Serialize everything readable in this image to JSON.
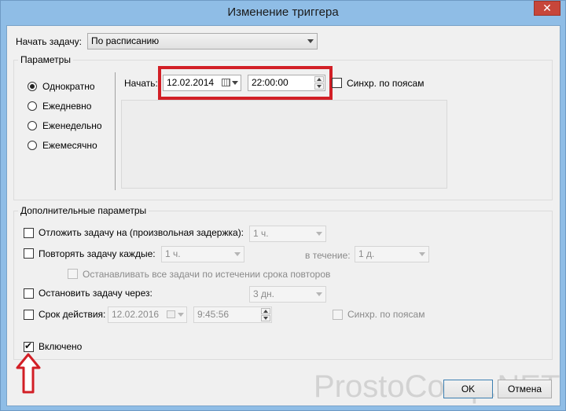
{
  "window": {
    "title": "Изменение триггера",
    "close_glyph": "✕"
  },
  "begin_task": {
    "label": "Начать задачу:",
    "value": "По расписанию"
  },
  "parameters": {
    "legend": "Параметры",
    "options": [
      {
        "label": "Однократно",
        "selected": true
      },
      {
        "label": "Ежедневно",
        "selected": false
      },
      {
        "label": "Еженедельно",
        "selected": false
      },
      {
        "label": "Ежемесячно",
        "selected": false
      }
    ],
    "start_label": "Начать:",
    "start_date": "12.02.2014",
    "start_time": "22:00:00",
    "sync_label": "Синхр. по поясам",
    "sync_checked": false
  },
  "advanced": {
    "legend": "Дополнительные параметры",
    "delay_label": "Отложить задачу на (произвольная задержка):",
    "delay_value": "1 ч.",
    "repeat_label": "Повторять задачу каждые:",
    "repeat_value": "1 ч.",
    "duration_label": "в течение:",
    "duration_value": "1 д.",
    "stop_all_label": "Останавливать все задачи по истечении срока повторов",
    "stop_after_label": "Остановить задачу через:",
    "stop_after_value": "3 дн.",
    "expire_label": "Срок действия:",
    "expire_date": "12.02.2016",
    "expire_time": "9:45:56",
    "expire_sync_label": "Синхр. по поясам",
    "enabled_label": "Включено",
    "enabled_checked": true
  },
  "buttons": {
    "ok": "OK",
    "cancel": "Отмена"
  },
  "watermark": "ProstoComp.NET",
  "colors": {
    "highlight": "#d21f26",
    "title_bar": "#8fbde6"
  },
  "icons": [
    "close-icon",
    "calendar-icon",
    "chevron-down-icon",
    "spin-up-icon",
    "spin-down-icon",
    "up-arrow-icon"
  ]
}
